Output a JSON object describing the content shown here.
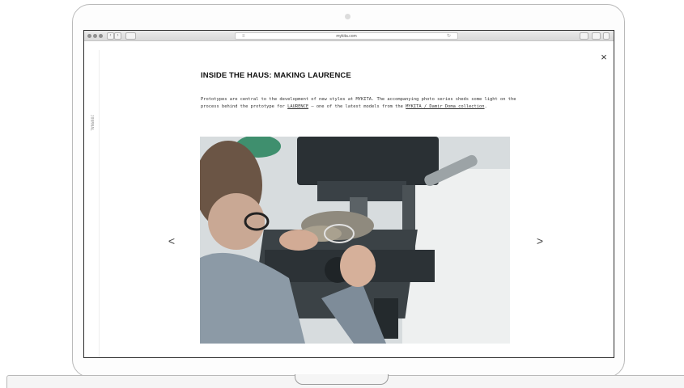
{
  "browser": {
    "url": "mykita.com",
    "back_glyph": "‹",
    "forward_glyph": "›",
    "reader_glyph": "≡",
    "reload_glyph": "↻"
  },
  "page": {
    "side_label": "JOURNAL",
    "close_glyph": "×",
    "title": "INSIDE THE HAUS: MAKING LAURENCE",
    "intro": {
      "part1": "Prototypes are central to the development of new styles at MYKITA. The accompanying photo series sheds some light on the process behind the prototype for ",
      "link1": "LAURENCE",
      "part2": " – one of the latest models from the ",
      "link2": "MYKITA / Damir Doma collection",
      "part3": "."
    },
    "prev_glyph": "<",
    "next_glyph": ">"
  },
  "icons": {
    "close": "close-icon",
    "prev": "chevron-left-icon",
    "next": "chevron-right-icon",
    "reload": "reload-icon",
    "reader": "reader-icon"
  }
}
